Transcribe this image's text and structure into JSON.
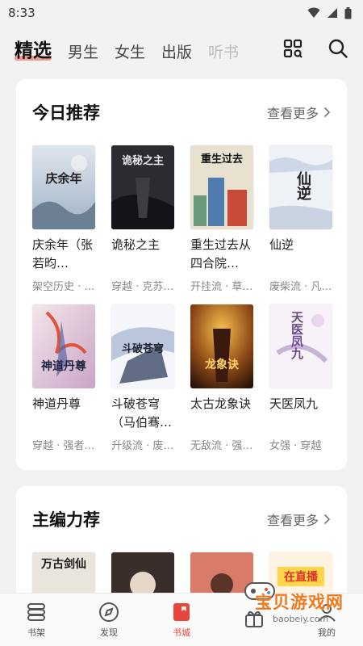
{
  "status_bar": {
    "time": "8:33"
  },
  "nav": {
    "tabs": [
      {
        "label": "精选",
        "active": true
      },
      {
        "label": "男生"
      },
      {
        "label": "女生"
      },
      {
        "label": "出版"
      },
      {
        "label": "听书"
      }
    ],
    "icons": [
      "grid-icon",
      "search-icon"
    ]
  },
  "today": {
    "title": "今日推荐",
    "more": "查看更多",
    "books": [
      {
        "title": "庆余年（张若昀…",
        "tags": "架空历史 · …",
        "cover_text": "庆余年"
      },
      {
        "title": "诡秘之主",
        "tags": "穿越 · 克苏…",
        "cover_text": "诡秘之主"
      },
      {
        "title": "重生过去从四合院…",
        "tags": "开挂流 · 草…",
        "cover_text": "重生过去"
      },
      {
        "title": "仙逆",
        "tags": "废柴流 · 凡…",
        "cover_text": "仙逆"
      },
      {
        "title": "神道丹尊",
        "tags": "穿越 · 强者…",
        "cover_text": "神道丹尊"
      },
      {
        "title": "斗破苍穹（马伯骞…",
        "tags": "升级流 · 废…",
        "cover_text": "斗破苍穹"
      },
      {
        "title": "太古龙象诀",
        "tags": "无敌流 · 强…",
        "cover_text": "龙象诀"
      },
      {
        "title": "天医凤九",
        "tags": "女强 · 穿越",
        "cover_text": "天医凤九"
      }
    ]
  },
  "editor": {
    "title": "主编力荐",
    "more": "查看更多",
    "covers": [
      "万古剑仙",
      "",
      "",
      "在直播"
    ]
  },
  "bottom_tabs": [
    {
      "label": "书架",
      "icon": "bookshelf-icon"
    },
    {
      "label": "发现",
      "icon": "compass-icon"
    },
    {
      "label": "书城",
      "icon": "book-icon",
      "active": true
    },
    {
      "label": "",
      "icon": "welfare-icon"
    },
    {
      "label": "我的",
      "icon": "profile-icon"
    }
  ],
  "watermark": {
    "title": "宝贝游戏网",
    "url": "baobeiy.com"
  },
  "colors": {
    "accent": "#e8453c",
    "watermark": "#f07a1d"
  }
}
